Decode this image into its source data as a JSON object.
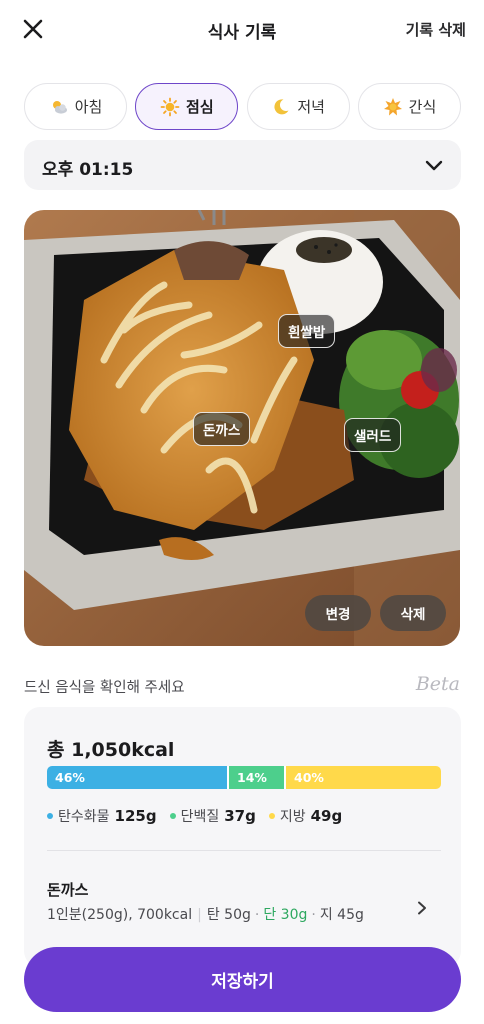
{
  "header": {
    "title": "식사 기록",
    "delete_label": "기록 삭제"
  },
  "meal_tabs": [
    {
      "label": "아침",
      "icon": "cloud-sun-icon",
      "active": false
    },
    {
      "label": "점심",
      "icon": "sun-icon",
      "active": true
    },
    {
      "label": "저녁",
      "icon": "moon-icon",
      "active": false
    },
    {
      "label": "간식",
      "icon": "sun-small-icon",
      "active": false
    }
  ],
  "time": {
    "value": "오후 01:15"
  },
  "photo": {
    "tags": [
      "흰쌀밥",
      "돈까스",
      "샐러드"
    ],
    "change_label": "변경",
    "delete_label": "삭제"
  },
  "confirm": {
    "text": "드신 음식을 확인해 주세요",
    "beta": "Beta"
  },
  "summary": {
    "total": "총 1,050kcal",
    "ratio": {
      "carb": "46%",
      "protein": "14%",
      "fat": "40%"
    },
    "carb_fraction": 0.46,
    "protein_fraction": 0.14,
    "fat_fraction": 0.4,
    "legend": [
      {
        "label": "탄수화물",
        "value": "125g",
        "color": "#3cb0e4"
      },
      {
        "label": "단백질",
        "value": "37g",
        "color": "#4dcf8c"
      },
      {
        "label": "지방",
        "value": "49g",
        "color": "#ffd94a"
      }
    ]
  },
  "food_item": {
    "name": "돈까스",
    "portion": "1인분(250g), 700kcal",
    "carb": "탄 50g",
    "protein": "단 30g",
    "fat": "지 45g"
  },
  "save_label": "저장하기",
  "colors": {
    "accent": "#6a3cd0",
    "active_border": "#6e46c9"
  }
}
